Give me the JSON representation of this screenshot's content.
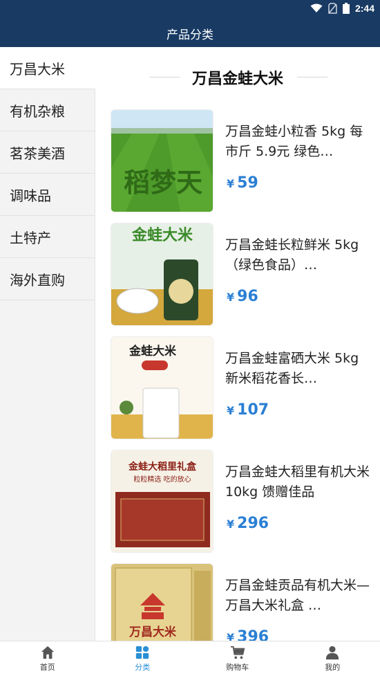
{
  "status_bar": {
    "time": "2:44"
  },
  "header": {
    "title": "产品分类"
  },
  "sidebar": {
    "items": [
      {
        "label": "万昌大米"
      },
      {
        "label": "有机杂粮"
      },
      {
        "label": "茗茶美酒"
      },
      {
        "label": "调味品"
      },
      {
        "label": "土特产"
      },
      {
        "label": "海外直购"
      }
    ]
  },
  "section": {
    "title": "万昌金蛙大米"
  },
  "products": [
    {
      "name": "万昌金蛙小粒香 5kg 每市斤 5.9元 绿色…",
      "currency": "¥",
      "price": "59",
      "image_text": "稻梦天"
    },
    {
      "name": "万昌金蛙长粒鲜米 5kg（绿色食品）…",
      "currency": "¥",
      "price": "96",
      "image_text": "金蛙大米"
    },
    {
      "name": "万昌金蛙富硒大米 5kg 新米稻花香长…",
      "currency": "¥",
      "price": "107",
      "image_text": "金蛙大米"
    },
    {
      "name": "万昌金蛙大稻里有机大米 10kg 馈赠佳品",
      "currency": "¥",
      "price": "296",
      "image_text": "金蛙大稻里礼盒",
      "image_subtext": "粒粒精选 吃的放心"
    },
    {
      "name": "万昌金蛙贡品有机大米—万昌大米礼盒 …",
      "currency": "¥",
      "price": "396",
      "image_text": "万昌大米"
    }
  ],
  "bottom_nav": {
    "tabs": [
      {
        "label": "首页"
      },
      {
        "label": "分类"
      },
      {
        "label": "购物车"
      },
      {
        "label": "我的"
      }
    ]
  },
  "colors": {
    "header_bg": "#183a63",
    "accent": "#2a8fd4",
    "price": "#2a7fd4"
  }
}
